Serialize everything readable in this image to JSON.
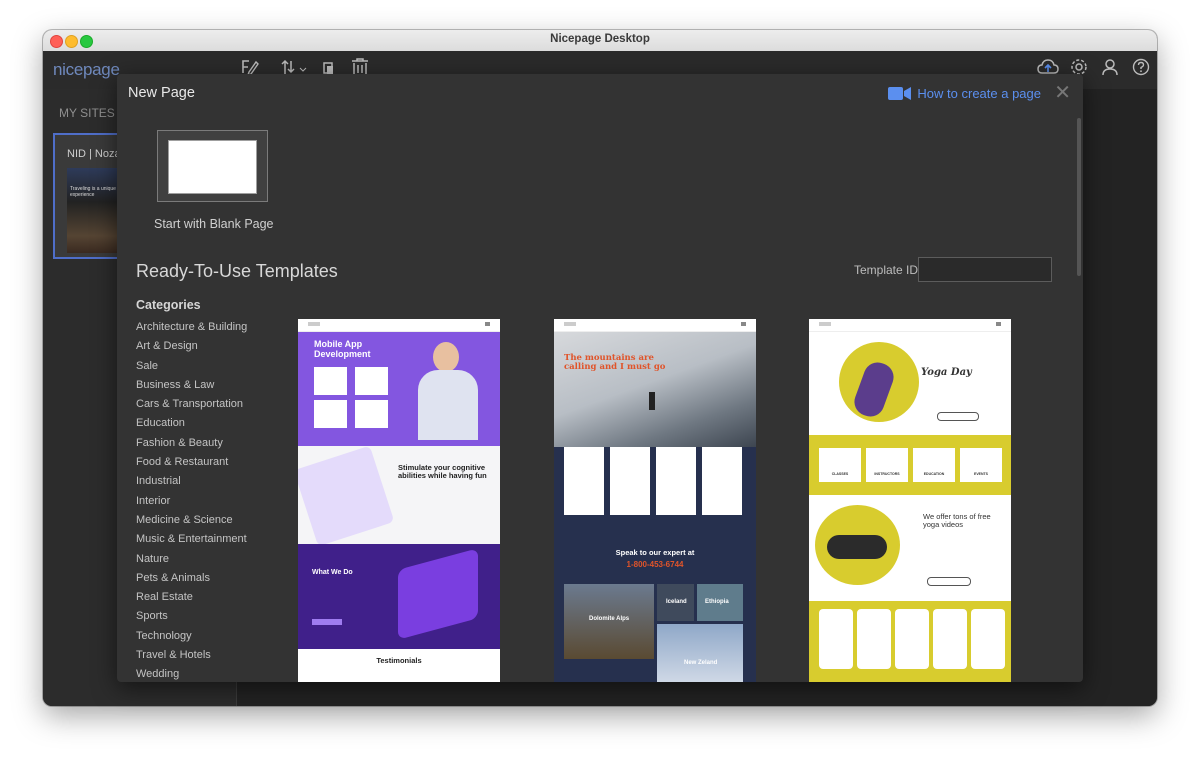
{
  "window": {
    "title": "Nicepage Desktop"
  },
  "app": {
    "logo": "nicepage",
    "toolbar_icons": [
      "brush-pencil-icon",
      "import-export-icon",
      "duplicate-icon",
      "trash-icon",
      "cloud-upload-icon",
      "settings-gear-icon",
      "user-icon",
      "help-icon"
    ],
    "my_sites_label": "MY SITES",
    "site_card": {
      "name": "NID | Noza",
      "thumb_text": "Traveling is a unique experience"
    }
  },
  "modal": {
    "title": "New Page",
    "how_to_label": "How to create a page",
    "blank_page_label": "Start with Blank Page",
    "templates_heading": "Ready-To-Use Templates",
    "template_id_label": "Template ID",
    "template_id_value": "",
    "categories_heading": "Categories",
    "categories": [
      "Architecture & Building",
      "Art & Design",
      "Sale",
      "Business & Law",
      "Cars & Transportation",
      "Education",
      "Fashion & Beauty",
      "Food & Restaurant",
      "Industrial",
      "Interior",
      "Medicine & Science",
      "Music & Entertainment",
      "Nature",
      "Pets & Animals",
      "Real Estate",
      "Sports",
      "Technology",
      "Travel & Hotels",
      "Wedding"
    ]
  },
  "templates": [
    {
      "heading": "Mobile App Development",
      "subheading": "Stimulate your cognitive abilities while having fun",
      "section": "What We Do",
      "footer": "Testimonials"
    },
    {
      "heading": "The mountains are calling and I must go",
      "cta": "Speak to our expert at",
      "phone": "1-800-453-6744",
      "places": [
        "Dolomite Alps",
        "Iceland",
        "Ethiopia",
        "New Zeland"
      ]
    },
    {
      "heading": "Yoga Day",
      "subheading": "We offer tons of free yoga videos",
      "features": [
        "CLASSES",
        "INSTRUCTORS",
        "EDUCATION",
        "EVENTS"
      ]
    }
  ],
  "colors": {
    "accent_link": "#5b8fef",
    "selection": "#4f6ec9",
    "template_purple": "#8356e0",
    "template_yellow": "#d8cc2e",
    "template_navy": "#26304e"
  }
}
